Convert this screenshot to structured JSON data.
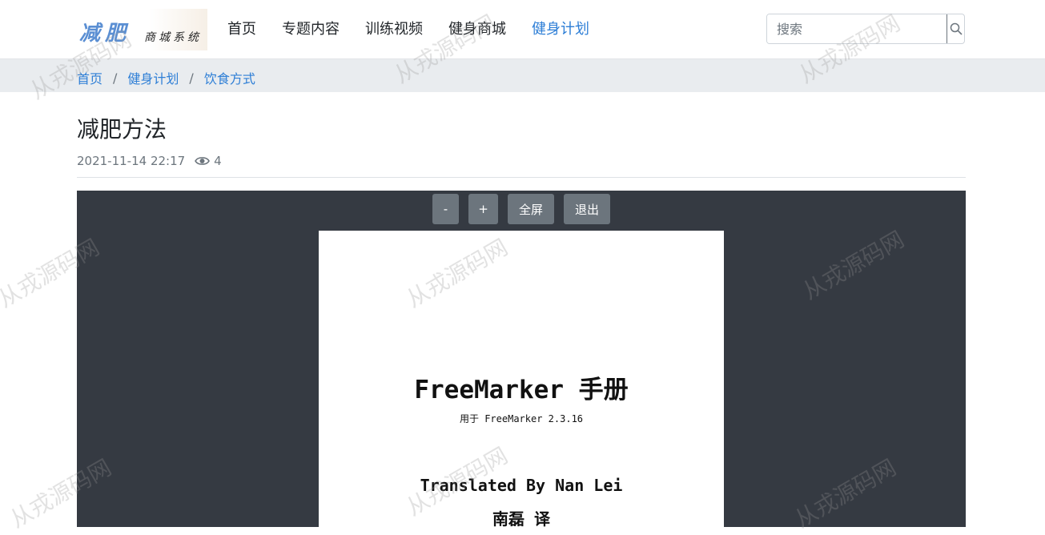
{
  "header": {
    "logo_main": "减肥",
    "logo_sub": "商城系统",
    "nav": [
      {
        "label": "首页",
        "active": false
      },
      {
        "label": "专题内容",
        "active": false
      },
      {
        "label": "训练视频",
        "active": false
      },
      {
        "label": "健身商城",
        "active": false
      },
      {
        "label": "健身计划",
        "active": true
      }
    ],
    "search_placeholder": "搜索",
    "search_icon": "search-icon"
  },
  "breadcrumb": [
    "首页",
    "健身计划",
    "饮食方式"
  ],
  "article": {
    "title": "减肥方法",
    "date": "2021-11-14 22:17",
    "views": "4",
    "views_icon": "eye-icon"
  },
  "viewer": {
    "controls": [
      "-",
      "+",
      "全屏",
      "退出"
    ],
    "page": {
      "title": "FreeMarker 手册",
      "subtitle": "用于 FreeMarker 2.3.16",
      "translated_by": "Translated By Nan Lei",
      "translator_cn": "南磊 译"
    }
  },
  "watermark": "从戎源码网",
  "colors": {
    "accent": "#2d7ed6",
    "viewer_bg": "#353a42",
    "control_bg": "#6c757d"
  }
}
